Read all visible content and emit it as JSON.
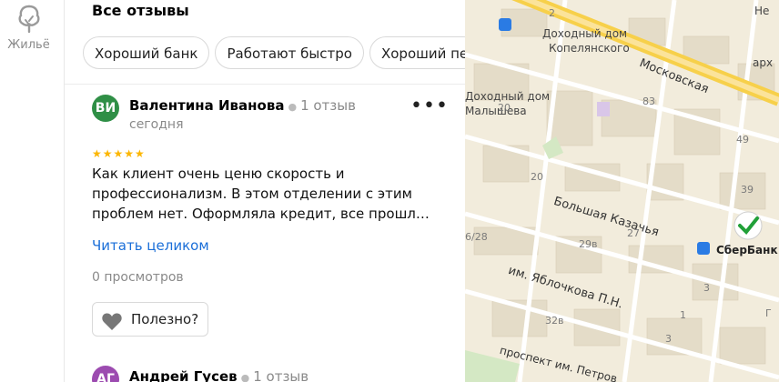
{
  "rail": {
    "housing_label": "Жильё"
  },
  "panel": {
    "title": "Все отзывы",
    "chips": [
      "Хороший банк",
      "Работают быстро",
      "Хороший пе"
    ]
  },
  "reviews": [
    {
      "initials": "ВИ",
      "author": "Валентина Иванова",
      "review_count": "1 отзыв",
      "date": "сегодня",
      "stars": "★★★★★",
      "text": "Как клиент очень ценю скорость и профессионализм. В этом отделении с этим проблем нет. Оформляла кредит, все прошл…",
      "read_more": "Читать целиком",
      "views": "0 просмотров",
      "useful_label": "Полезно?"
    },
    {
      "initials": "АГ",
      "author": "Андрей Гусев",
      "review_count": "1 отзыв"
    }
  ],
  "map": {
    "poi": [
      "Доходный дом",
      "Копелянского",
      "Доходный дом",
      "Малышева",
      "арх",
      "Не",
      "СберБанк"
    ],
    "streets": [
      "Московская",
      "Большая Казачья",
      "им. Яблочкова П.Н.",
      "проспект им. Петров"
    ],
    "house_numbers": [
      "2",
      "83",
      "49",
      "39",
      "20",
      "20",
      "29в",
      "27",
      "6/28",
      "32в",
      "3",
      "3",
      "1",
      "Г"
    ],
    "colors": {
      "major_road": "#f7d04a",
      "bank_green": "#21a038"
    }
  }
}
